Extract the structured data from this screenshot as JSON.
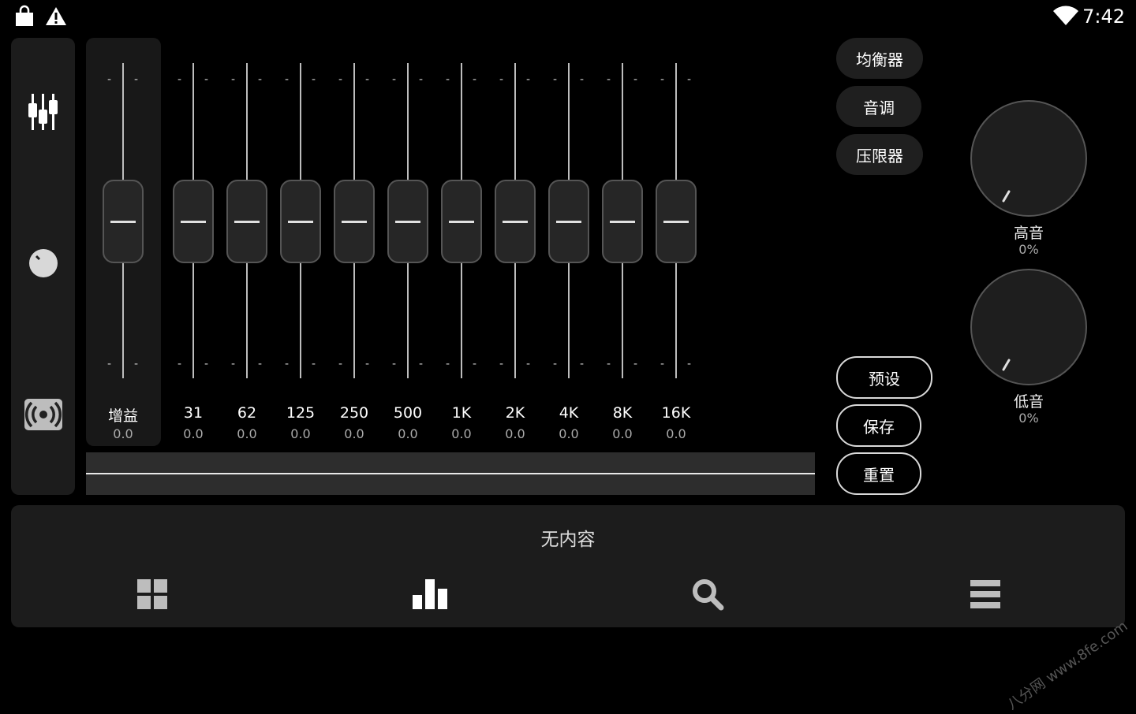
{
  "status_bar": {
    "time": "7:42",
    "left_icons": [
      "shopping-bag-icon",
      "warning-icon"
    ],
    "right_icons": [
      "wifi-icon"
    ]
  },
  "sidebar": {
    "items": [
      {
        "icon": "equalizer-sliders-icon"
      },
      {
        "icon": "knob-icon"
      },
      {
        "icon": "surround-speaker-icon"
      }
    ]
  },
  "equalizer": {
    "gain": {
      "label": "增益",
      "value": "0.0"
    },
    "bands": [
      {
        "freq": "31",
        "value": "0.0"
      },
      {
        "freq": "62",
        "value": "0.0"
      },
      {
        "freq": "125",
        "value": "0.0"
      },
      {
        "freq": "250",
        "value": "0.0"
      },
      {
        "freq": "500",
        "value": "0.0"
      },
      {
        "freq": "1K",
        "value": "0.0"
      },
      {
        "freq": "2K",
        "value": "0.0"
      },
      {
        "freq": "4K",
        "value": "0.0"
      },
      {
        "freq": "8K",
        "value": "0.0"
      },
      {
        "freq": "16K",
        "value": "0.0"
      }
    ]
  },
  "tabs": {
    "equalizer": "均衡器",
    "tone": "音调",
    "limiter": "压限器"
  },
  "dials": {
    "treble": {
      "label": "高音",
      "value": "0%"
    },
    "bass": {
      "label": "低音",
      "value": "0%"
    }
  },
  "actions": {
    "preset": "预设",
    "save": "保存",
    "reset": "重置"
  },
  "player": {
    "now_playing": "无内容",
    "nav_icons": [
      "grid-icon",
      "bar-chart-icon",
      "search-icon",
      "menu-icon"
    ]
  },
  "watermark": "八分网 www.8fe.com"
}
